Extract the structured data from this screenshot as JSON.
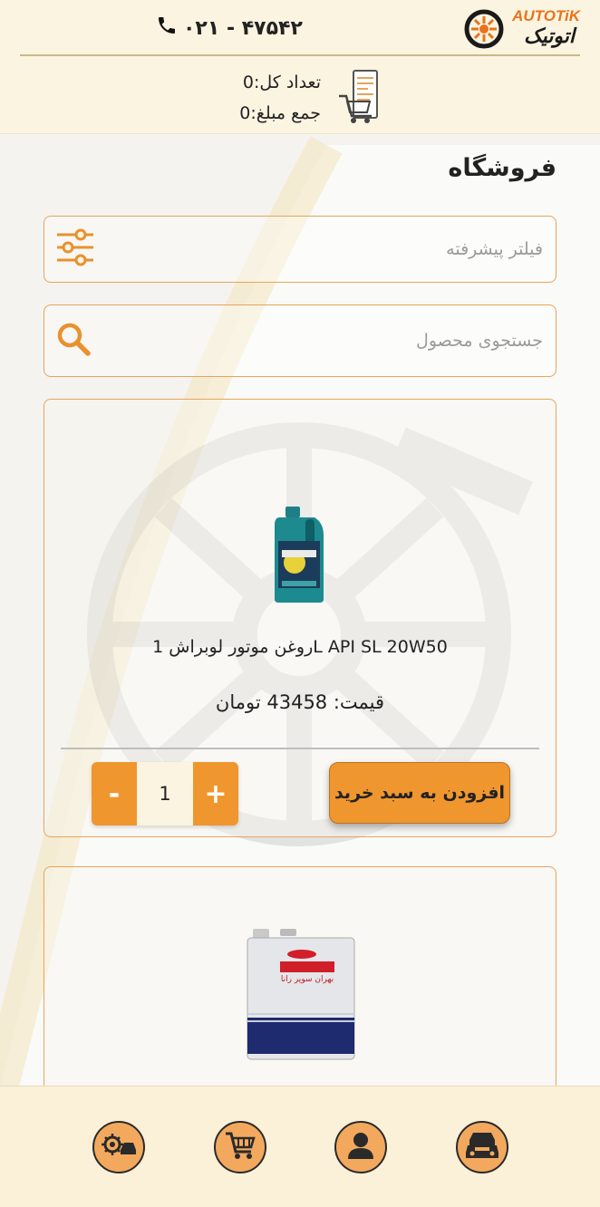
{
  "header": {
    "phone": "۰۲۱ - ۴۷۵۴۲",
    "logo_brand": "AUTOTiK",
    "logo_fa": "اتوتیک"
  },
  "cart_summary": {
    "count_text": "تعداد کل:0",
    "total_text": "جمع مبلغ:0"
  },
  "page": {
    "title": "فروشگاه"
  },
  "filter": {
    "placeholder": "فیلتر پیشرفته"
  },
  "search": {
    "placeholder": "جستجوی محصول"
  },
  "products": [
    {
      "name": "روغن موتور لوبراش 1L API SL 20W50",
      "price_text": "قیمت: 43458 تومان",
      "quantity": "1",
      "minus_label": "-",
      "plus_label": "+",
      "add_label": "افزودن به سبد خرید"
    },
    {
      "can_label": "بهران سوپر رانا"
    }
  ],
  "colors": {
    "accent": "#f0962f",
    "border": "#e8a45a",
    "header_bg": "#fbf4e0",
    "nav_bg": "#fbf0d8"
  },
  "nav": {
    "items": [
      "gear-car-icon",
      "cart-icon",
      "user-icon",
      "cars-icon"
    ]
  }
}
